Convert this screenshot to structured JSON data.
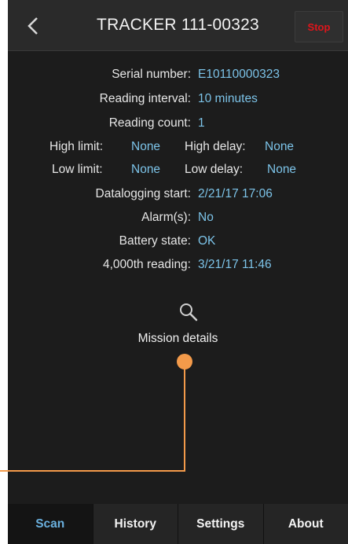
{
  "header": {
    "title": "TRACKER  111-00323",
    "stop_label": "Stop"
  },
  "details": {
    "serial_label": "Serial number:",
    "serial_value": "E10110000323",
    "interval_label": "Reading interval:",
    "interval_value": "10 minutes",
    "count_label": "Reading count:",
    "count_value": "1",
    "high_limit_label": "High limit:",
    "high_limit_value": "None",
    "high_delay_label": "High delay:",
    "high_delay_value": "None",
    "low_limit_label": "Low limit:",
    "low_limit_value": "None",
    "low_delay_label": "Low delay:",
    "low_delay_value": "None",
    "start_label": "Datalogging start:",
    "start_value": "2/21/17 17:06",
    "alarms_label": "Alarm(s):",
    "alarms_value": "No",
    "battery_label": "Battery state:",
    "battery_value": "OK",
    "reading4000_label": "4,000th reading:",
    "reading4000_value": "3/21/17 11:46"
  },
  "mission": {
    "label": "Mission details",
    "icon": "search-icon"
  },
  "tabs": [
    {
      "label": "Scan",
      "active": true
    },
    {
      "label": "History",
      "active": false
    },
    {
      "label": "Settings",
      "active": false
    },
    {
      "label": "About",
      "active": false
    }
  ],
  "colors": {
    "accent": "#7cc3e8",
    "stop": "#e0151b",
    "callout": "#f39a4a"
  }
}
